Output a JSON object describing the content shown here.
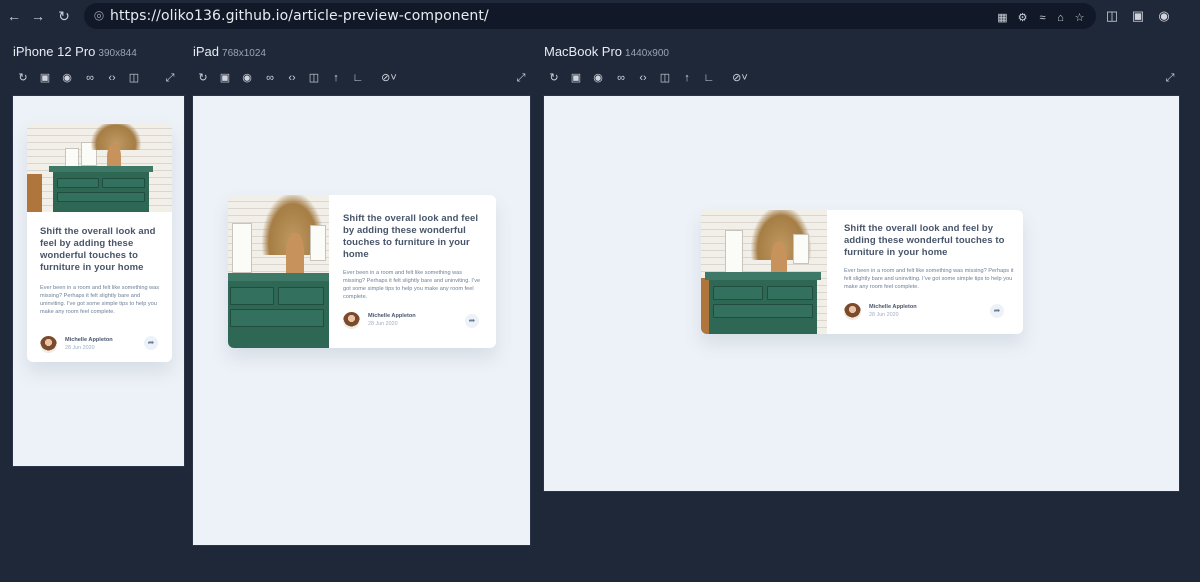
{
  "browser": {
    "url": "https://oliko136.github.io/article-preview-component/",
    "nav_icons": [
      "back-icon",
      "forward-icon",
      "reload-icon"
    ],
    "url_icons": [
      "extensions-icon",
      "translate-icon",
      "wifi-icon",
      "home-icon",
      "star-icon"
    ],
    "ext_icons": [
      "responsive-viewer-icon",
      "devtools-icon",
      "screenshot-icon"
    ]
  },
  "devices": [
    {
      "name": "iPhone 12 Pro",
      "size": "390x844"
    },
    {
      "name": "iPad",
      "size": "768x1024"
    },
    {
      "name": "MacBook Pro",
      "size": "1440x900"
    }
  ],
  "toolbar_icons": [
    "refresh-icon",
    "screenshot-edit-icon",
    "camera-icon",
    "link-icon",
    "code-icon",
    "rotate-device-icon",
    "scroll-up-icon",
    "ruler-icon",
    "hide-icon",
    "fullscreen-icon"
  ],
  "article": {
    "title": "Shift the overall look and feel by adding these wonderful touches to furniture in your home",
    "description": "Ever been in a room and felt like something was missing? Perhaps it felt slightly bare and uninviting. I’ve got some simple tips to help you make any room feel complete.",
    "author": "Michelle Appleton",
    "date": "28 Jun 2020",
    "share_icon": "share-icon"
  },
  "colors": {
    "background": "#1f2839",
    "viewport": "#edf2f8",
    "title": "#48556a",
    "text": "#6e8098",
    "dresser": "#2f6755"
  }
}
